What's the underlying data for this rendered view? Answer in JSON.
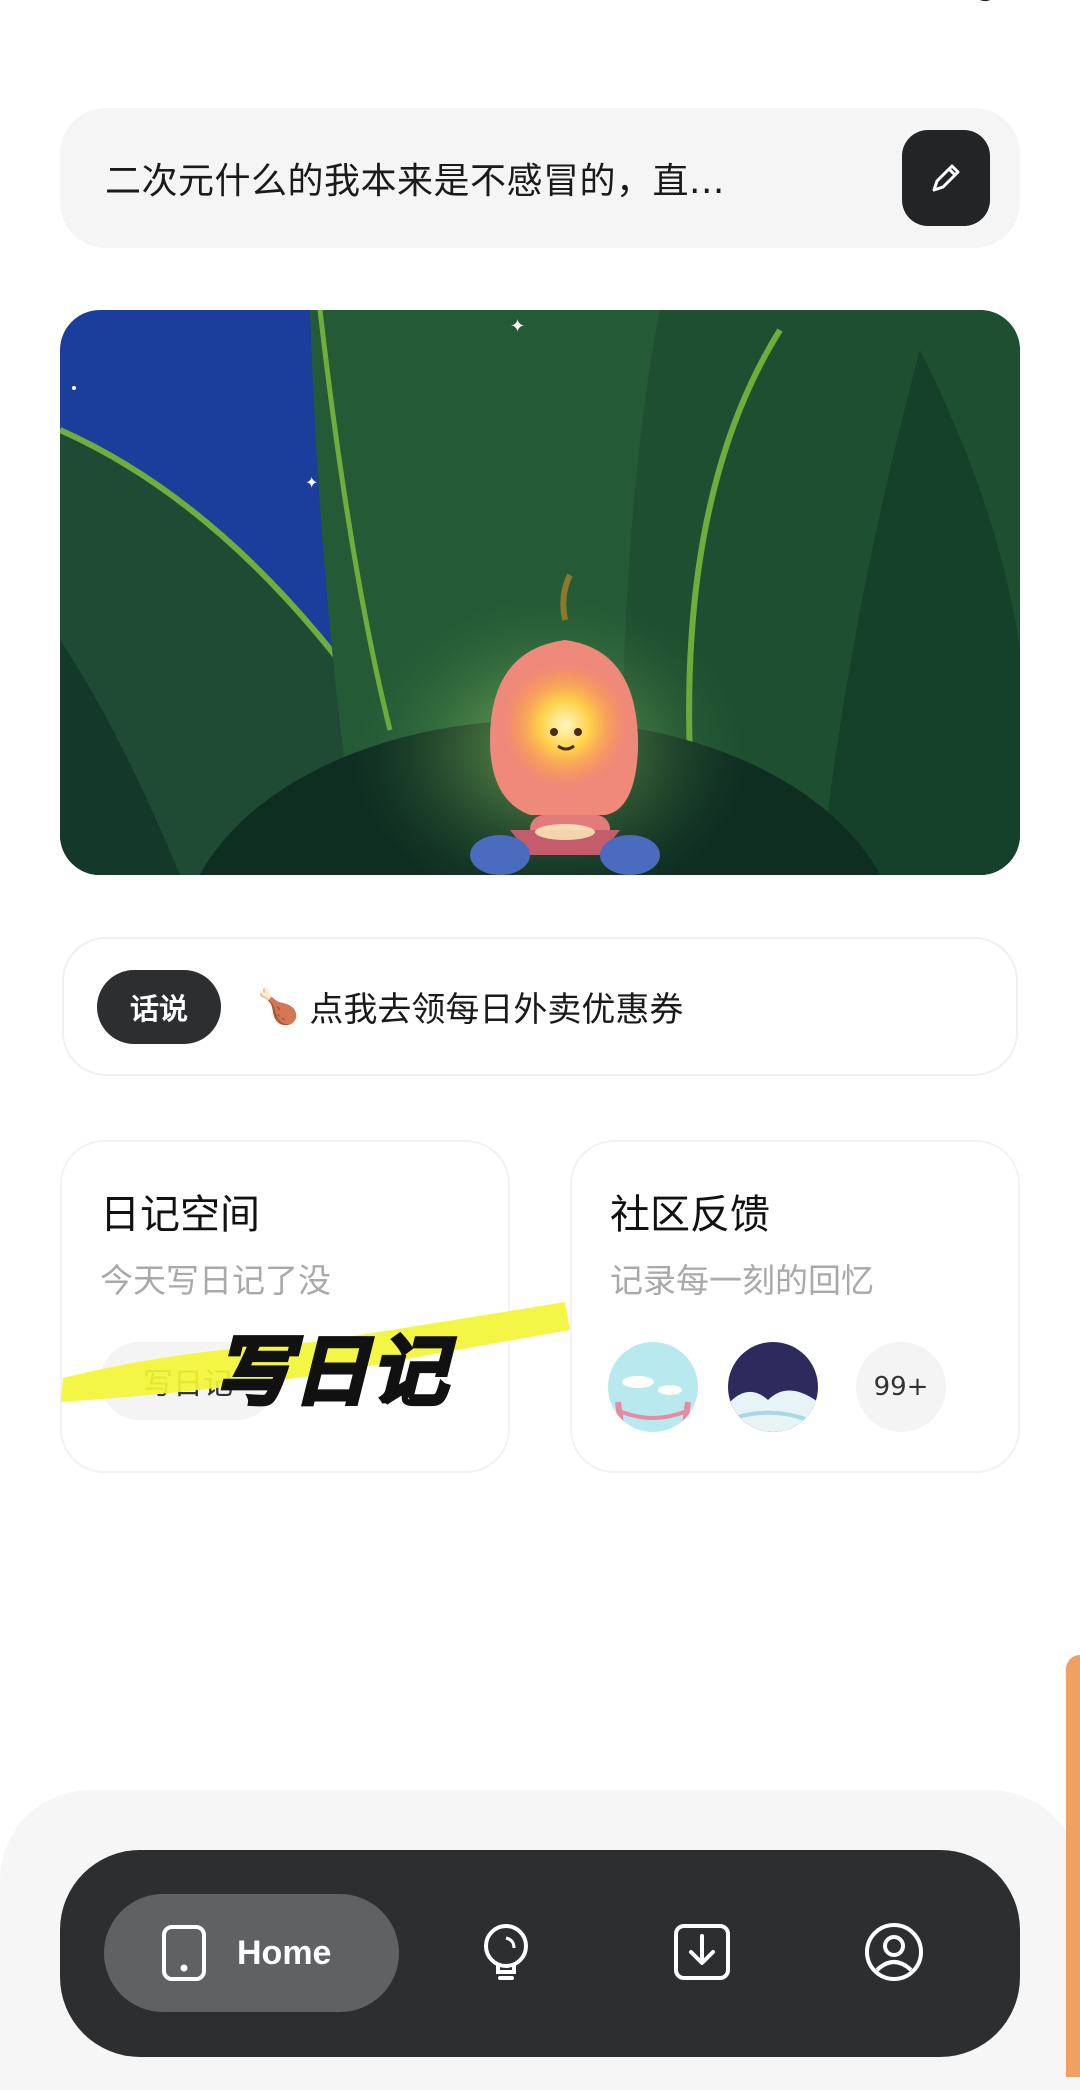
{
  "input": {
    "text": "二次元什么的我本来是不感冒的，直..."
  },
  "announcement": {
    "tag": "话说",
    "icon": "🍗",
    "text": "点我去领每日外卖优惠券"
  },
  "cards": {
    "diary": {
      "title": "日记空间",
      "subtitle": "今天写日记了没",
      "button": "写日记"
    },
    "community": {
      "title": "社区反馈",
      "subtitle": "记录每一刻的回忆",
      "count": "99+"
    }
  },
  "overlay": {
    "caption": "写日记",
    "highlight_color": "#f3f535"
  },
  "tabbar": {
    "home_label": "Home",
    "icons": [
      "phone-icon",
      "lightbulb-icon",
      "download-icon",
      "profile-icon"
    ]
  },
  "colors": {
    "dark": "#2c2e30",
    "accent_orange": "#f0a060",
    "banner_sky": "#1a3a9a"
  }
}
